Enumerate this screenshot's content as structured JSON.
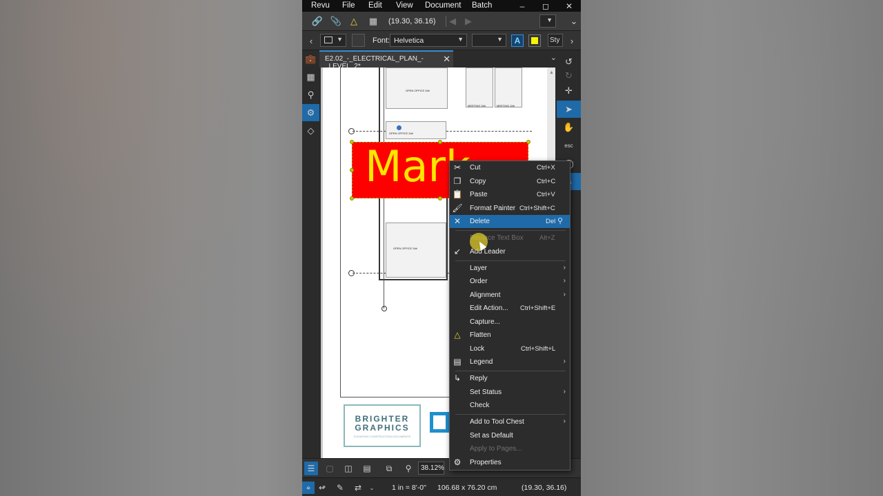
{
  "menubar": {
    "items": [
      "Revu",
      "File",
      "Edit",
      "View",
      "Document",
      "Batch"
    ],
    "window_controls": [
      "minimize",
      "maximize",
      "close"
    ]
  },
  "toolbar1": {
    "coords": "(19.30, 36.16)",
    "icons": [
      "link-icon",
      "paperclip-icon",
      "flatten-bell-icon",
      "select-markups-icon",
      "first-page-icon",
      "prev-page-icon"
    ]
  },
  "toolbar2": {
    "font_label": "Font:",
    "font_value": "Helvetica",
    "style_label": "Sty"
  },
  "document_tab": {
    "title": "E2.02_-_ELECTRICAL_PLAN_-_LEVEL_2*"
  },
  "markup": {
    "text": "Mark",
    "fill_color": "#ff0000",
    "text_color": "#ffe600"
  },
  "logo": {
    "line1": "BRIGHTER",
    "line2": "GRAPHICS",
    "tagline": "ELEVATING CONSTRUCTION DOCUMENTS"
  },
  "drawing_labels": {
    "room1": "OPEN OFFICE 2##",
    "room2": "MEETING 2##",
    "room3": "MEETING 2##",
    "room4": "OPEN OFFICE 2##",
    "room5": "OPEN OFFICE 2##"
  },
  "bottom_bar": {
    "zoom": "38.12%"
  },
  "status_bar": {
    "scale": "1 in = 8'-0\"",
    "page_size": "106.68 x 76.20 cm",
    "coords": "(19.30, 36.16)"
  },
  "context_menu": {
    "cut": {
      "label": "Cut",
      "shortcut": "Ctrl+X"
    },
    "copy": {
      "label": "Copy",
      "shortcut": "Ctrl+C"
    },
    "paste": {
      "label": "Paste",
      "shortcut": "Ctrl+V"
    },
    "format_painter": {
      "label": "Format Painter",
      "shortcut": "Ctrl+Shift+C"
    },
    "delete": {
      "label": "Delete",
      "shortcut": "Del"
    },
    "replace_text_box": {
      "label": "Replace Text Box",
      "shortcut": "Alt+Z"
    },
    "add_leader": {
      "label": "Add Leader"
    },
    "layer": {
      "label": "Layer"
    },
    "order": {
      "label": "Order"
    },
    "alignment": {
      "label": "Alignment"
    },
    "edit_action": {
      "label": "Edit Action...",
      "shortcut": "Ctrl+Shift+E"
    },
    "capture": {
      "label": "Capture..."
    },
    "flatten": {
      "label": "Flatten"
    },
    "lock": {
      "label": "Lock",
      "shortcut": "Ctrl+Shift+L"
    },
    "legend": {
      "label": "Legend"
    },
    "reply": {
      "label": "Reply"
    },
    "set_status": {
      "label": "Set Status"
    },
    "check": {
      "label": "Check"
    },
    "add_to_tool_chest": {
      "label": "Add to Tool Chest"
    },
    "set_as_default": {
      "label": "Set as Default"
    },
    "apply_to_pages": {
      "label": "Apply to Pages..."
    },
    "properties": {
      "label": "Properties"
    }
  },
  "colors": {
    "accent": "#1f6aa8",
    "menu_bg": "#2c2c2c"
  }
}
